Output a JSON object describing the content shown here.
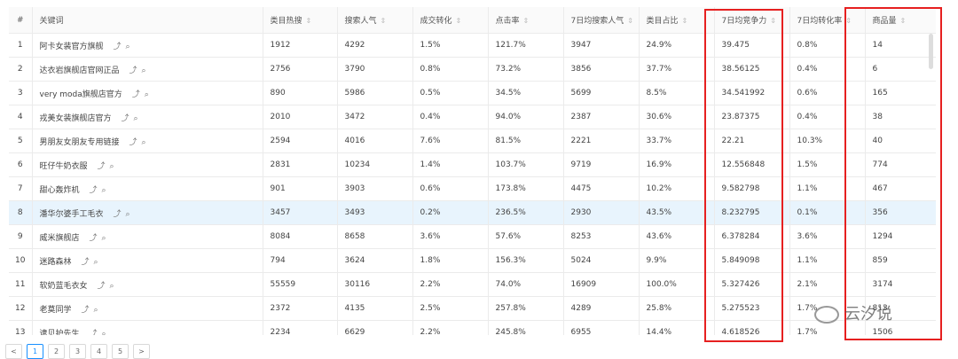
{
  "columns": [
    {
      "label": "#",
      "sortable": false
    },
    {
      "label": "关键词",
      "sortable": false
    },
    {
      "label": "类目热搜",
      "sortable": true
    },
    {
      "label": "搜索人气",
      "sortable": true
    },
    {
      "label": "成交转化",
      "sortable": true
    },
    {
      "label": "点击率",
      "sortable": true
    },
    {
      "label": "7日均搜索人气",
      "sortable": true
    },
    {
      "label": "类目占比",
      "sortable": true
    },
    {
      "label": "7日均竞争力",
      "sortable": true
    },
    {
      "label": "7日均转化率",
      "sortable": true
    },
    {
      "label": "商品量",
      "sortable": true
    }
  ],
  "rows": [
    [
      "1",
      "阿卡女装官方旗舰",
      "1912",
      "4292",
      "1.5%",
      "121.7%",
      "3947",
      "24.9%",
      "39.475",
      "0.8%",
      "14"
    ],
    [
      "2",
      "达衣岩旗舰店官网正品",
      "2756",
      "3790",
      "0.8%",
      "73.2%",
      "3856",
      "37.7%",
      "38.56125",
      "0.4%",
      "6"
    ],
    [
      "3",
      "very moda旗舰店官方",
      "890",
      "5986",
      "0.5%",
      "34.5%",
      "5699",
      "8.5%",
      "34.541992",
      "0.6%",
      "165"
    ],
    [
      "4",
      "戎美女装旗舰店官方",
      "2010",
      "3472",
      "0.4%",
      "94.0%",
      "2387",
      "30.6%",
      "23.87375",
      "0.4%",
      "38"
    ],
    [
      "5",
      "男朋友女朋友专用链接",
      "2594",
      "4016",
      "7.6%",
      "81.5%",
      "2221",
      "33.7%",
      "22.21",
      "10.3%",
      "40"
    ],
    [
      "6",
      "旺仔牛奶衣服",
      "2831",
      "10234",
      "1.4%",
      "103.7%",
      "9719",
      "16.9%",
      "12.556848",
      "1.5%",
      "774"
    ],
    [
      "7",
      "甜心轰炸机",
      "901",
      "3903",
      "0.6%",
      "173.8%",
      "4475",
      "10.2%",
      "9.582798",
      "1.1%",
      "467"
    ],
    [
      "8",
      "潘华尔婆手工毛衣",
      "3457",
      "3493",
      "0.2%",
      "236.5%",
      "2930",
      "43.5%",
      "8.232795",
      "0.1%",
      "356"
    ],
    [
      "9",
      "威米旗舰店",
      "8084",
      "8658",
      "3.6%",
      "57.6%",
      "8253",
      "43.6%",
      "6.378284",
      "3.6%",
      "1294"
    ],
    [
      "10",
      "迷路森林",
      "794",
      "3624",
      "1.8%",
      "156.3%",
      "5024",
      "9.9%",
      "5.849098",
      "1.1%",
      "859"
    ],
    [
      "11",
      "软奶蓝毛衣女",
      "55559",
      "30116",
      "2.2%",
      "74.0%",
      "16909",
      "100.0%",
      "5.327426",
      "2.1%",
      "3174"
    ],
    [
      "12",
      "老莫同学",
      "2372",
      "4135",
      "2.5%",
      "257.8%",
      "4289",
      "25.8%",
      "5.275523",
      "1.7%",
      "813"
    ],
    [
      "13",
      "逮贝护先生",
      "2234",
      "6629",
      "2.2%",
      "245.8%",
      "6955",
      "14.4%",
      "4.618526",
      "1.7%",
      "1506"
    ]
  ],
  "highlight_row": 8,
  "pagination": {
    "prev": "<",
    "pages": [
      "1",
      "2",
      "3",
      "4",
      "5"
    ],
    "active": "1",
    "next": ">"
  },
  "watermark": "云汐说",
  "colors": {
    "highlight_box": "#e62020",
    "row_highlight": "#e8f4fd",
    "active_page": "#1890ff"
  },
  "icons": {
    "trend": "trend-icon",
    "search": "search-icon",
    "sort": "sort-icon"
  }
}
